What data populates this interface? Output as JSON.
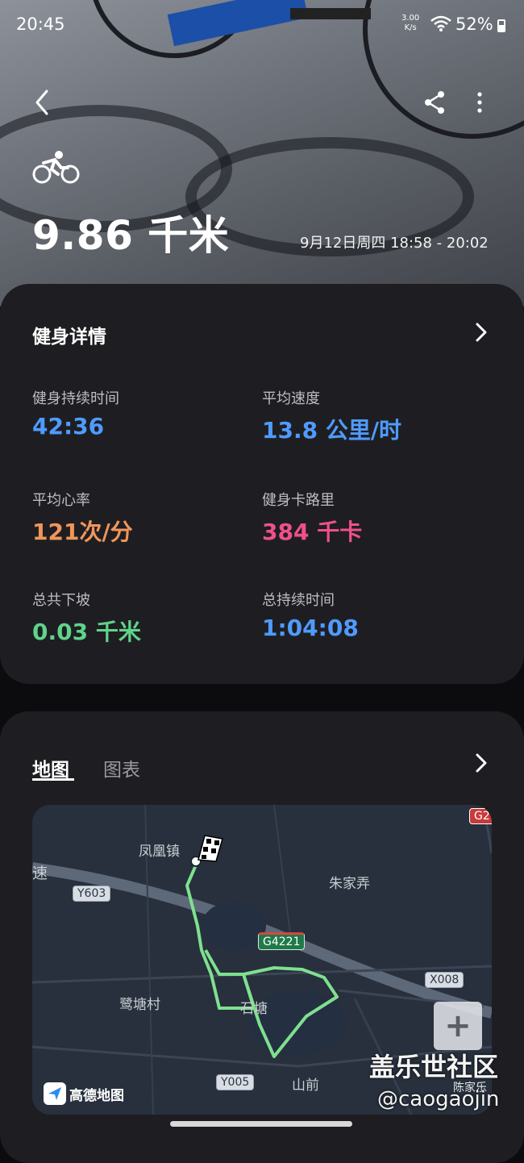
{
  "status_bar": {
    "time": "20:45",
    "net_speed_value": "3.00",
    "net_speed_unit": "K/s",
    "battery": "52%"
  },
  "header": {
    "distance": "9.86 千米",
    "datetime": "9月12日周四 18:58 - 20:02",
    "activity_icon": "cycling-icon"
  },
  "details": {
    "title": "健身详情",
    "stats": [
      {
        "label": "健身持续时间",
        "value": "42:36",
        "color": "#4f9bff"
      },
      {
        "label": "平均速度",
        "value": "13.8 公里/时",
        "color": "#4f9bff"
      },
      {
        "label": "平均心率",
        "value": "121次/分",
        "color": "#f0955a"
      },
      {
        "label": "健身卡路里",
        "value": "384 千卡",
        "color": "#f0508a"
      },
      {
        "label": "总共下坡",
        "value": "0.03 千米",
        "color": "#5fd38a"
      },
      {
        "label": "总持续时间",
        "value": "1:04:08",
        "color": "#4f9bff"
      }
    ]
  },
  "map_card": {
    "tabs": [
      {
        "label": "地图",
        "active": true
      },
      {
        "label": "图表",
        "active": false
      }
    ],
    "map": {
      "labels": [
        "凤凰镇",
        "速",
        "朱家弄",
        "鹭塘村",
        "石塘",
        "山前",
        "陈家乐"
      ],
      "road_tags": [
        "Y603",
        "G4221",
        "X008",
        "Y005",
        "G2"
      ],
      "provider": "高德地图",
      "zoom_in_symbol": "+",
      "route_color": "#7fe08f"
    }
  },
  "watermark": {
    "line1": "盖乐世社区",
    "line2": "@caogaojin"
  }
}
